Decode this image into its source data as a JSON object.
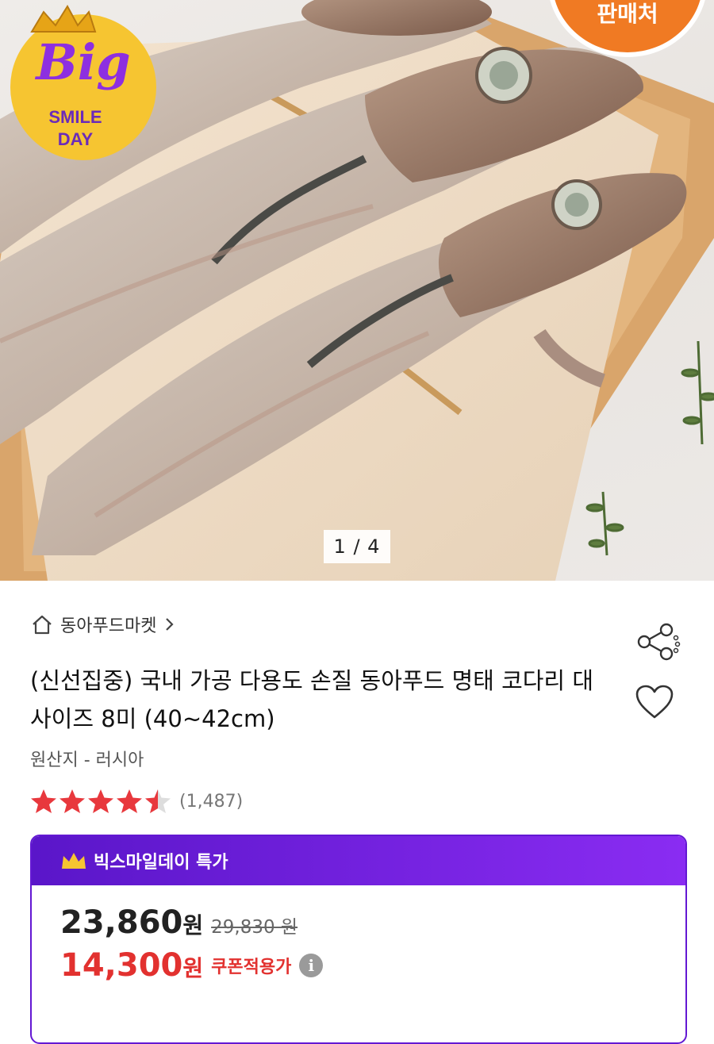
{
  "gallery": {
    "pager": "1 / 4",
    "seller_badge": "판매처",
    "event_badge": {
      "big": "Big",
      "line1": "SMILE",
      "line2": "DAY"
    }
  },
  "store": {
    "name": "동아푸드마켓"
  },
  "product": {
    "title": "(신선집중) 국내 가공 다용도 손질 동아푸드 명태 코다리 대 사이즈 8미 (40~42cm)",
    "origin": "원산지 - 러시아",
    "rating_value": 4.5,
    "review_count": "(1,487)"
  },
  "deal": {
    "header": "빅스마일데이 특가",
    "price": "23,860",
    "price_unit": "원",
    "original_price": "29,830 원",
    "coupon_price": "14,300",
    "coupon_unit": "원",
    "coupon_label": "쿠폰적용가"
  },
  "colors": {
    "accent_purple": "#6318d3",
    "sale_red": "#e2312f",
    "star_red": "#e8383d",
    "badge_orange": "#f07a23"
  }
}
